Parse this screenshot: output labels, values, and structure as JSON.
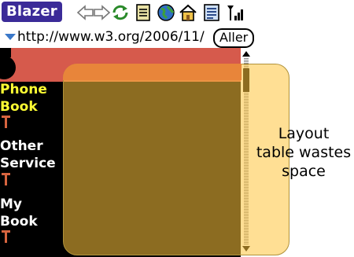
{
  "toolbar": {
    "brand": "Blazer",
    "icons": [
      "back-icon",
      "forward-icon",
      "refresh-icon",
      "bookmarks-icon",
      "globe-icon",
      "home-icon",
      "page-info-icon",
      "signal-icon"
    ]
  },
  "urlbar": {
    "url": "http://www.w3.org/2006/11/",
    "go_label": "Aller"
  },
  "page": {
    "nav": [
      {
        "line1": "Phone",
        "line2": "Book",
        "active": true
      },
      {
        "line1": "Other",
        "line2": "Service",
        "active": false
      },
      {
        "line1": "My",
        "line2": "Book",
        "active": false
      }
    ],
    "colors": {
      "banner": "#d65a4c",
      "accent": "#e8853a",
      "active_nav": "#ffff33"
    }
  },
  "annotation": {
    "lines": [
      "Layout",
      "table wastes",
      "space"
    ],
    "color": "#ffc53c"
  }
}
